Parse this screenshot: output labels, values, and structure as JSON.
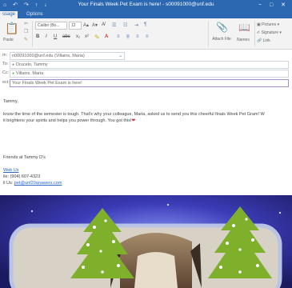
{
  "window": {
    "title": "Your Finals Week Pet Exam is here! - s00091000@unf.edu",
    "quick_access": "⌂ ↶ ↷ ↑ ↓",
    "window_controls": "− □ ✕"
  },
  "tabs": [
    {
      "label": "ssage",
      "active": true
    },
    {
      "label": "Options",
      "active": false
    }
  ],
  "ribbon": {
    "paste_label": "Paste",
    "font_name": "Calibri (Bo...",
    "font_size": "12",
    "attach_label": "Attach File",
    "names_label": "Names",
    "pictures_label": "Pictures",
    "signature_label": "Signature",
    "link_label": "Link"
  },
  "header": {
    "from_label": "m:",
    "from_value": "n00091000@unf.edu (Villains, Maria)",
    "to_label": "To:",
    "to_value": "Drucelo, Tammy",
    "cc_label": "Cc:",
    "cc_value": "Villains, Maria",
    "subject_label": "ect:",
    "subject_value": "Your Finals Week Pet Exam is here!"
  },
  "body": {
    "greeting": "Tammy,",
    "line1": "know the time of the semester is tough. That's why your colleague, Maria, asked us to send you this cheerful finals Week Pet Gram! W",
    "line2": "it brightens your spirits and helps you power through. You got this!",
    "heart": "❤",
    "signoff": "Friends at Tammy D's",
    "sig_link": "Web Us",
    "sig_phone": "ile: (904) 607-4323",
    "sig_email_label": "il Us:",
    "sig_email": "pet@unf20anawers.com"
  },
  "colors": {
    "titlebar": "#2b68b1",
    "ribbon": "#f3f3f3",
    "link": "#2a67c8",
    "heart": "#d12d2d",
    "tree": "#7fb02c",
    "photo_bg": "#2b2a8a"
  }
}
